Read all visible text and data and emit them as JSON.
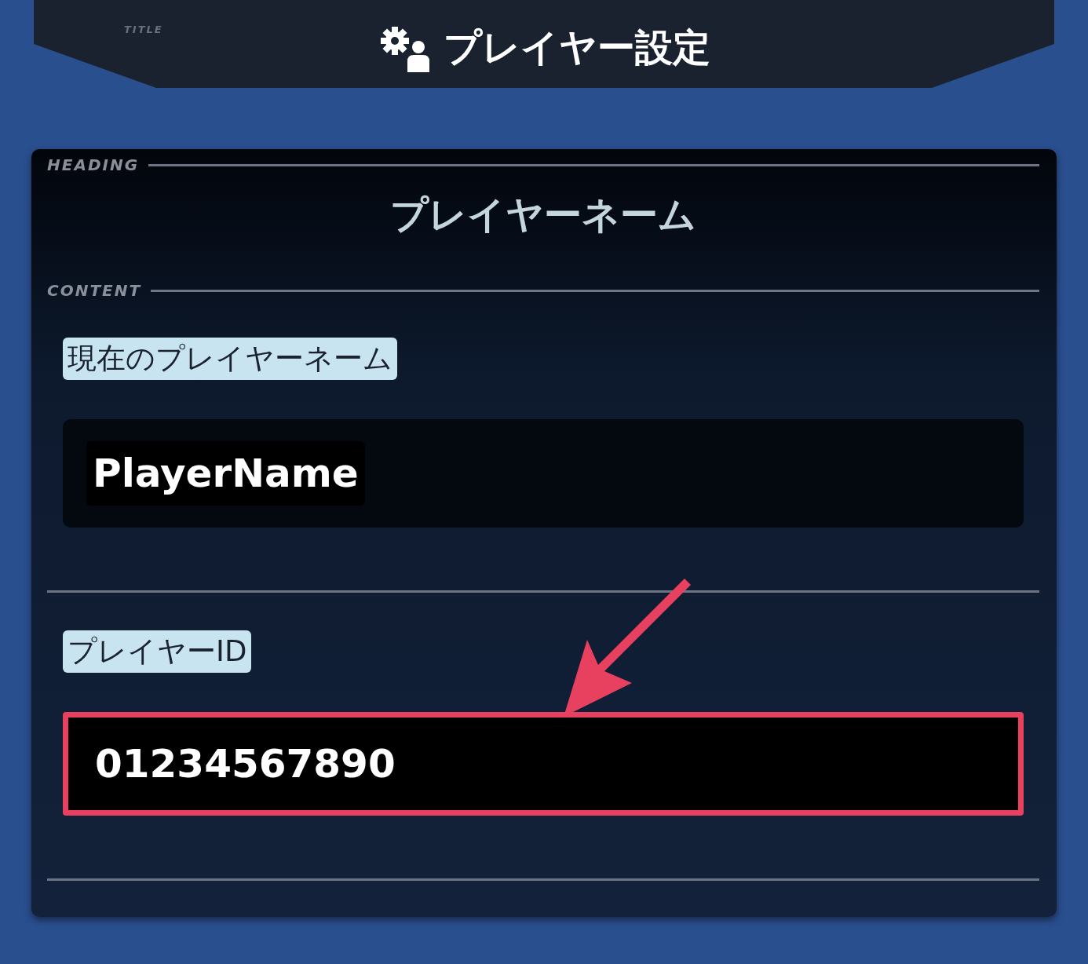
{
  "title_bar": {
    "tag": "TITLE",
    "title": "プレイヤー設定"
  },
  "panel": {
    "heading_tag": "HEADING",
    "heading": "プレイヤーネーム",
    "content_tag": "CONTENT",
    "sections": [
      {
        "label": "現在のプレイヤーネーム",
        "value": "PlayerName",
        "highlighted": false
      },
      {
        "label": "プレイヤーID",
        "value": "01234567890",
        "highlighted": true
      }
    ]
  }
}
